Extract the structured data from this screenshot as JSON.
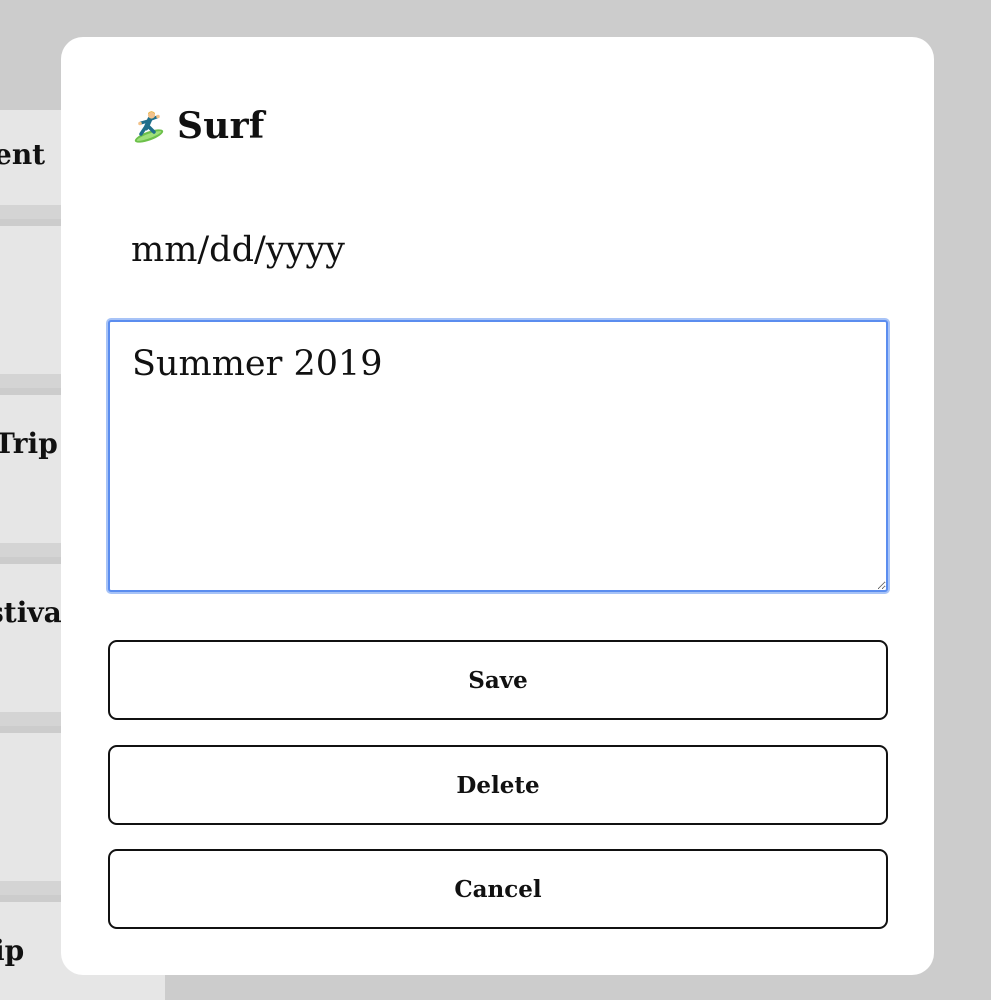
{
  "background": {
    "cards": [
      {
        "label": "ent"
      },
      {
        "label": ""
      },
      {
        "label": "Trip"
      },
      {
        "label": "stival"
      },
      {
        "label": ""
      },
      {
        "label": "ip"
      }
    ]
  },
  "modal": {
    "icon": "surfer-icon",
    "title": "Surf",
    "date_input": {
      "placeholder": "mm/dd/yyyy",
      "value": ""
    },
    "notes": {
      "value": "Summer 2019"
    },
    "buttons": {
      "save": "Save",
      "delete": "Delete",
      "cancel": "Cancel"
    }
  },
  "colors": {
    "focus_ring": "#5b8def",
    "overlay": "#cccccc"
  }
}
